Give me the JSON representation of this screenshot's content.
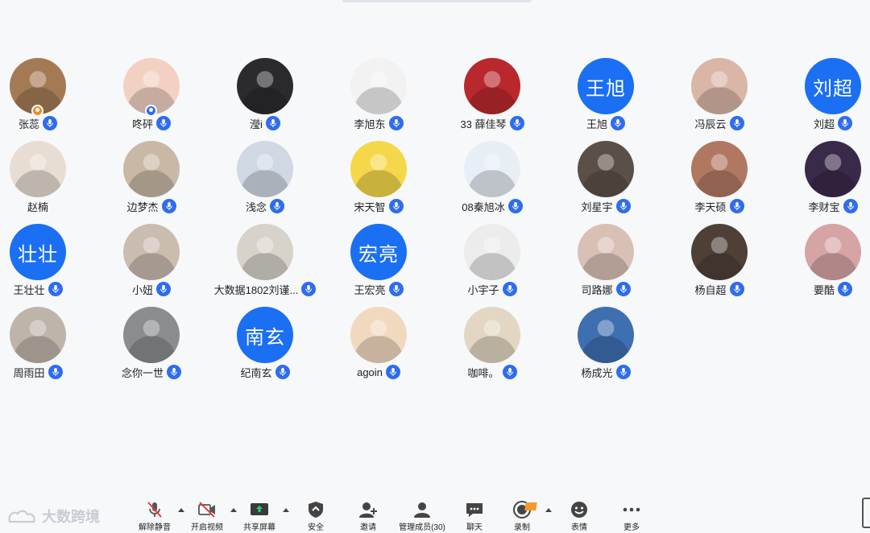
{
  "participants": [
    {
      "name": "张蕊",
      "avatar_text": "",
      "avatar_kind": "bear",
      "host_badge": "orange",
      "mic": "on"
    },
    {
      "name": "咚砰",
      "avatar_text": "",
      "avatar_kind": "person",
      "host_badge": "blue",
      "mic": "on"
    },
    {
      "name": "瀅i",
      "avatar_text": "",
      "avatar_kind": "dark",
      "host_badge": "",
      "mic": "on"
    },
    {
      "name": "李旭东",
      "avatar_text": "",
      "avatar_kind": "meme",
      "host_badge": "",
      "mic": "on"
    },
    {
      "name": "33  薛佳琴",
      "avatar_text": "",
      "avatar_kind": "red",
      "host_badge": "",
      "mic": "on"
    },
    {
      "name": "王旭",
      "avatar_text": "王旭",
      "avatar_kind": "text",
      "host_badge": "",
      "mic": "on"
    },
    {
      "name": "冯辰云",
      "avatar_text": "",
      "avatar_kind": "face",
      "host_badge": "",
      "mic": "on"
    },
    {
      "name": "刘超",
      "avatar_text": "刘超",
      "avatar_kind": "text",
      "host_badge": "",
      "mic": "on"
    },
    {
      "name": "赵楠",
      "avatar_text": "",
      "avatar_kind": "dog",
      "host_badge": "",
      "mic": "none"
    },
    {
      "name": "边梦杰",
      "avatar_text": "",
      "avatar_kind": "kid",
      "host_badge": "",
      "mic": "on"
    },
    {
      "name": "浅念",
      "avatar_text": "",
      "avatar_kind": "bear2",
      "host_badge": "",
      "mic": "on"
    },
    {
      "name": "宋天智",
      "avatar_text": "",
      "avatar_kind": "sponge",
      "host_badge": "",
      "mic": "on"
    },
    {
      "name": "08秦旭冰",
      "avatar_text": "",
      "avatar_kind": "flower",
      "host_badge": "",
      "mic": "on"
    },
    {
      "name": "刘星宇",
      "avatar_text": "",
      "avatar_kind": "dark2",
      "host_badge": "",
      "mic": "on"
    },
    {
      "name": "李天硕",
      "avatar_text": "",
      "avatar_kind": "kid2",
      "host_badge": "",
      "mic": "on"
    },
    {
      "name": "李财宝",
      "avatar_text": "",
      "avatar_kind": "night",
      "host_badge": "",
      "mic": "on"
    },
    {
      "name": "王壮壮",
      "avatar_text": "壮壮",
      "avatar_kind": "text",
      "host_badge": "",
      "mic": "on"
    },
    {
      "name": "小妞",
      "avatar_text": "",
      "avatar_kind": "girl",
      "host_badge": "",
      "mic": "on"
    },
    {
      "name": "大数据1802刘谨...",
      "avatar_text": "",
      "avatar_kind": "cat",
      "host_badge": "",
      "mic": "on"
    },
    {
      "name": "王宏亮",
      "avatar_text": "宏亮",
      "avatar_kind": "text",
      "host_badge": "",
      "mic": "on"
    },
    {
      "name": "小宇子",
      "avatar_text": "",
      "avatar_kind": "meme2",
      "host_badge": "",
      "mic": "on"
    },
    {
      "name": "司路娜",
      "avatar_text": "",
      "avatar_kind": "girl2",
      "host_badge": "",
      "mic": "on"
    },
    {
      "name": "杨自超",
      "avatar_text": "",
      "avatar_kind": "man",
      "host_badge": "",
      "mic": "on"
    },
    {
      "name": "要酷",
      "avatar_text": "",
      "avatar_kind": "pink",
      "host_badge": "",
      "mic": "on"
    },
    {
      "name": "周雨田",
      "avatar_text": "",
      "avatar_kind": "boy",
      "host_badge": "",
      "mic": "on"
    },
    {
      "name": "念你一世",
      "avatar_text": "",
      "avatar_kind": "suit",
      "host_badge": "",
      "mic": "on"
    },
    {
      "name": "纪南玄",
      "avatar_text": "南玄",
      "avatar_kind": "text",
      "host_badge": "",
      "mic": "on"
    },
    {
      "name": "agoin",
      "avatar_text": "",
      "avatar_kind": "shin",
      "host_badge": "",
      "mic": "on"
    },
    {
      "name": "咖啡。",
      "avatar_text": "",
      "avatar_kind": "watch",
      "host_badge": "",
      "mic": "on"
    },
    {
      "name": "杨成光",
      "avatar_text": "",
      "avatar_kind": "sky",
      "host_badge": "",
      "mic": "on"
    }
  ],
  "toolbar": {
    "logo_text": "大数跨境",
    "items": [
      {
        "key": "unmute",
        "label": "解除静音",
        "icon": "mic-muted-icon"
      },
      {
        "key": "start_video",
        "label": "开启视频",
        "icon": "video-off-icon"
      },
      {
        "key": "share",
        "label": "共享屏幕",
        "icon": "share-screen-icon"
      },
      {
        "key": "security",
        "label": "安全",
        "icon": "shield-icon"
      },
      {
        "key": "invite",
        "label": "邀请",
        "icon": "add-user-icon"
      },
      {
        "key": "participants",
        "label": "管理成员(30)",
        "icon": "participants-icon"
      },
      {
        "key": "chat",
        "label": "聊天",
        "icon": "chat-icon"
      },
      {
        "key": "record",
        "label": "录制",
        "icon": "record-icon"
      },
      {
        "key": "reactions",
        "label": "表情",
        "icon": "emoji-icon"
      },
      {
        "key": "more",
        "label": "更多",
        "icon": "more-icon"
      }
    ]
  },
  "colors": {
    "accent": "#1a6ff2",
    "mic": "#2e6cf0",
    "background": "#f7f8fa",
    "record_tag": "#f39a2b"
  }
}
